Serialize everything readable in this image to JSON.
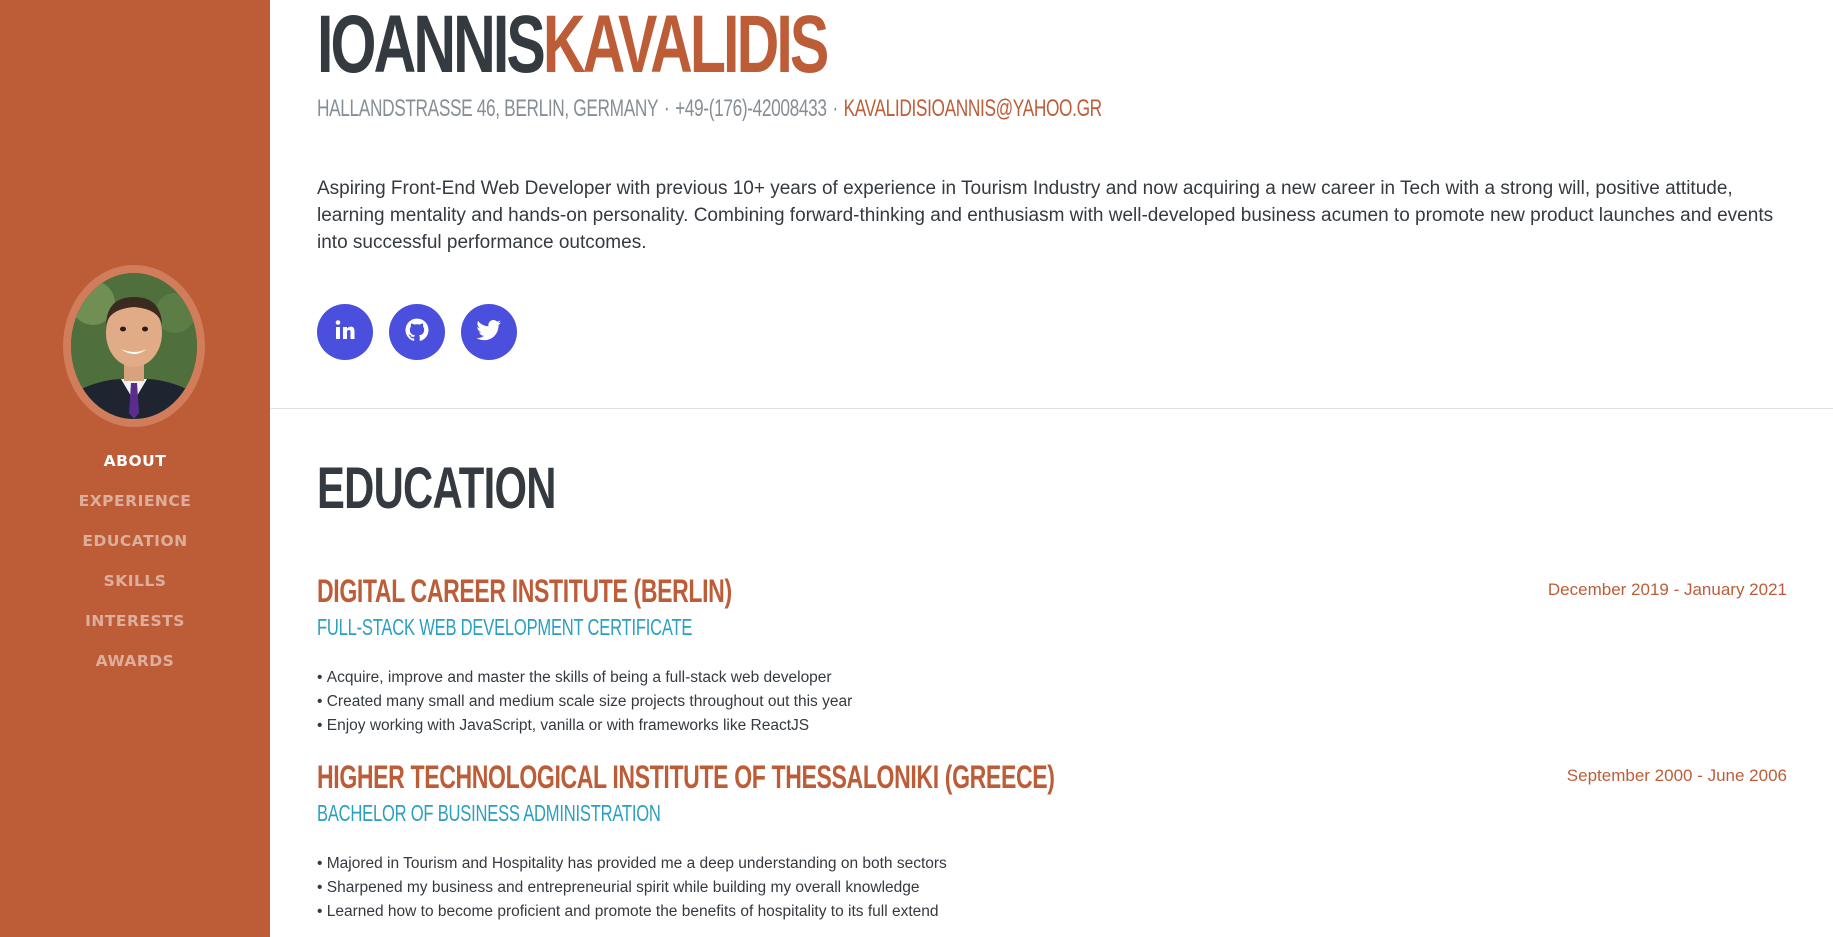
{
  "profile": {
    "first_name": "IOANNIS",
    "last_name": "KAVALIDIS",
    "address": "HALLANDSTRASSE 46, BERLIN, GERMANY",
    "phone": "+49-(176)-42008433",
    "email": "KAVALIDISIOANNIS@YAHOO.GR",
    "separator": "·",
    "summary": "Aspiring Front-End Web Developer with previous 10+ years of experience in Tourism Industry and now acquiring a new career in Tech with a strong will, positive attitude, learning mentality and hands-on personality. Combining forward-thinking and enthusiasm with well-developed business acumen to promote new product launches and events into successful performance outcomes."
  },
  "social": [
    {
      "name": "linkedin",
      "icon": "linkedin-icon"
    },
    {
      "name": "github",
      "icon": "github-icon"
    },
    {
      "name": "twitter",
      "icon": "twitter-icon"
    }
  ],
  "nav": {
    "items": [
      {
        "label": "ABOUT",
        "active": true
      },
      {
        "label": "EXPERIENCE",
        "active": false
      },
      {
        "label": "EDUCATION",
        "active": false
      },
      {
        "label": "SKILLS",
        "active": false
      },
      {
        "label": "INTERESTS",
        "active": false
      },
      {
        "label": "AWARDS",
        "active": false
      }
    ]
  },
  "education": {
    "title": "EDUCATION",
    "entries": [
      {
        "institution": "DIGITAL CAREER INSTITUTE (BERLIN)",
        "degree": "FULL-STACK WEB DEVELOPMENT CERTIFICATE",
        "date": "December 2019 - January 2021",
        "bullets": [
          "Acquire, improve and master the skills of being a full-stack web developer",
          "Created many small and medium scale size projects throughout out this year",
          "Enjoy working with JavaScript, vanilla or with frameworks like ReactJS"
        ]
      },
      {
        "institution": "HIGHER TECHNOLOGICAL INSTITUTE OF THESSALONIKI (GREECE)",
        "degree": "BACHELOR OF BUSINESS ADMINISTRATION",
        "date": "September 2000 - June 2006",
        "bullets": [
          "Majored in Tourism and Hospitality has provided me a deep understanding on both sectors",
          "Sharpened my business and entrepreneurial spirit while building my overall knowledge",
          "Learned how to become proficient and promote the benefits of hospitality to its full extend"
        ]
      }
    ]
  },
  "colors": {
    "primary": "#bd5d38",
    "accent_blue": "#2a9fc0",
    "social_bg": "#4a4fdd",
    "text_dark": "#343a40",
    "text_muted": "#868e96"
  }
}
